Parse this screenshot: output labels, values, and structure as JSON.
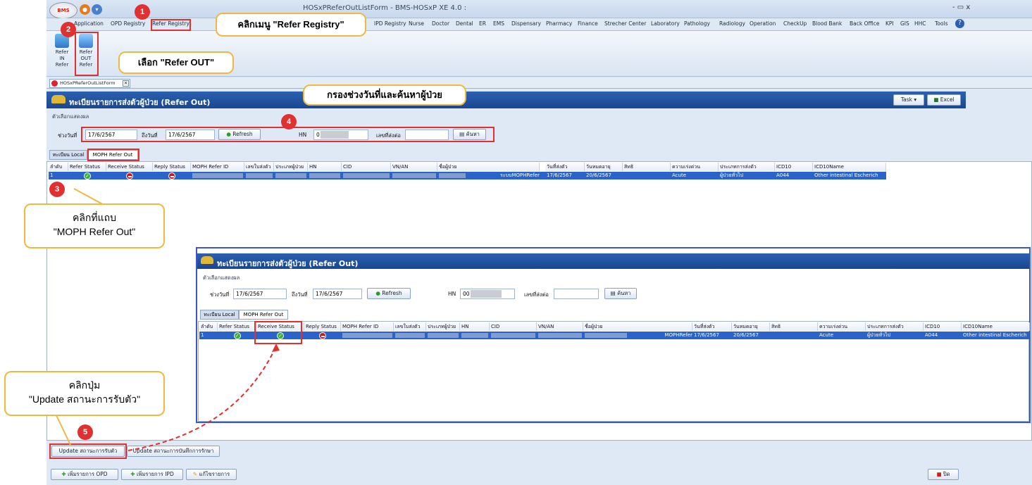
{
  "window": {
    "title": "HOSxPReferOutListForm - BMS-HOSxP XE 4.0 :",
    "controls": "-  ▭  x",
    "logo": "BMS"
  },
  "menu": {
    "items": [
      "Application",
      "OPD Registry",
      "Refer Registry",
      "IPD Registry",
      "Nurse",
      "Doctor",
      "Dental",
      "ER",
      "EMS",
      "Dispensary",
      "Pharmacy",
      "Finance",
      "Strecher Center",
      "Laboratory",
      "Pathology",
      "Radiology",
      "Operation",
      "CheckUp",
      "Blood Bank",
      "Back Office",
      "KPI",
      "GIS",
      "HHC",
      "Tools"
    ]
  },
  "ribbon": {
    "refer_in": [
      "Refer",
      "IN",
      "Refer"
    ],
    "refer_out": [
      "Refer",
      "OUT",
      "Refer"
    ]
  },
  "doc_tab": "HOSxPReferOutListForm",
  "header": {
    "title": "ทะเบียนรายการส่งตัวผู้ป่วย (Refer Out)",
    "task": "Task",
    "excel": "Excel"
  },
  "options_label": "ตัวเลือกแสดงผล",
  "filter": {
    "from_label": "ช่วงวันที่",
    "from": "17/6/2567",
    "to_label": "ถึงวันที่",
    "to": "17/6/2567",
    "refresh": "Refresh",
    "hn_label": "HN",
    "hn": "0",
    "refer_no_label": "เลขที่ส่งต่อ",
    "search": "ค้นหา"
  },
  "inset_filter": {
    "hn": "00"
  },
  "tabs": {
    "local": "ทะเบียน Local",
    "moph": "MOPH Refer Out"
  },
  "grid": {
    "headers": [
      "ลำดับ",
      "Refer Status",
      "Receive Status",
      "Reply Status",
      "MOPH Refer ID",
      "เลขใบส่งตัว",
      "ประเภทผู้ป่วย",
      "HN",
      "CID",
      "VN/AN",
      "ชื่อผู้ป่วย",
      "วันที่ส่งตัว",
      "วันหมดอายุ",
      "สิทธิ",
      "ความเร่งด่วน",
      "ประเภทการส่งตัว",
      "ICD10",
      "ICD10Name"
    ],
    "row": {
      "no": "1",
      "name": "ระบบMOPHRefer",
      "name_inset": "MOPHRefer",
      "sent": "17/6/2567",
      "expire": "20/6/2567",
      "urgency": "Acute",
      "type": "ผู้ป่วยทั่วไป",
      "icd10": "A044",
      "icd10name": "Other intestinal Escherich",
      "icd10name_inset": "Other intestinal Escherich"
    }
  },
  "bottom": {
    "update_receive": "Update สถานะการรับตัว",
    "update_record": "Update สถานะการบันทึกการรักษา",
    "add_opd": "เพิ่มรายการ OPD",
    "add_ipd": "เพิ่มรายการ IPD",
    "edit": "แก้ไขรายการ",
    "close": "ปิด"
  },
  "callouts": {
    "c1": "คลิกเมนู \"Refer Registry\"",
    "c2": "เลือก \"Refer OUT\"",
    "c4": "กรองช่วงวันที่และค้นหาผู้ป่วย",
    "c3_line1": "คลิกที่แถบ",
    "c3_line2": "\"MOPH Refer Out\"",
    "c5_line1": "คลิกปุ่ม",
    "c5_line2": "\"Update สถานะการรับตัว\""
  },
  "steps": [
    "1",
    "2",
    "3",
    "4",
    "5"
  ],
  "colors": {
    "header_blue": "#1a4690",
    "selected_row": "#2a63c9",
    "highlight_red": "#e03030",
    "callout_border": "#f0b840",
    "inset_border": "#3b55d6"
  }
}
